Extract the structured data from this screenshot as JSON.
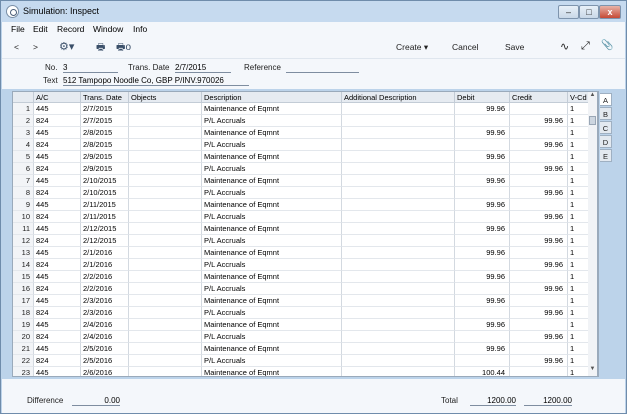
{
  "window": {
    "title": "Simulation: Inspect",
    "min_label": "–",
    "max_label": "□",
    "close_label": "x"
  },
  "menubar": [
    {
      "label": "File"
    },
    {
      "label": "Edit"
    },
    {
      "label": "Record"
    },
    {
      "label": "Window"
    },
    {
      "label": "Info"
    }
  ],
  "toolbar": {
    "back": "<",
    "forward": ">",
    "gear": "⚙▾",
    "print": "🖶",
    "preview": "🖶o",
    "create": "Create ▾",
    "cancel": "Cancel",
    "save": "Save",
    "wave": "∿",
    "expand": "⤢",
    "attach": "📎"
  },
  "header": {
    "no_label": "No.",
    "no_value": "3",
    "transdate_label": "Trans. Date",
    "transdate_value": "2/7/2015",
    "reference_label": "Reference",
    "reference_value": "",
    "text_label": "Text",
    "text_value": "512 Tampopo Noodle Co, GBP  P/INV.970026"
  },
  "grid": {
    "columns": [
      "",
      "A/C",
      "Trans. Date",
      "Objects",
      "Description",
      "Additional Description",
      "Debit",
      "Credit",
      "V-Cd"
    ],
    "rows": [
      [
        "1",
        "445",
        "2/7/2015",
        "",
        "Maintenance of Eqmnt",
        "",
        "99.96",
        "",
        "1"
      ],
      [
        "2",
        "824",
        "2/7/2015",
        "",
        "P/L  Accruals",
        "",
        "",
        "99.96",
        "1"
      ],
      [
        "3",
        "445",
        "2/8/2015",
        "",
        "Maintenance of Eqmnt",
        "",
        "99.96",
        "",
        "1"
      ],
      [
        "4",
        "824",
        "2/8/2015",
        "",
        "P/L  Accruals",
        "",
        "",
        "99.96",
        "1"
      ],
      [
        "5",
        "445",
        "2/9/2015",
        "",
        "Maintenance of Eqmnt",
        "",
        "99.96",
        "",
        "1"
      ],
      [
        "6",
        "824",
        "2/9/2015",
        "",
        "P/L  Accruals",
        "",
        "",
        "99.96",
        "1"
      ],
      [
        "7",
        "445",
        "2/10/2015",
        "",
        "Maintenance of Eqmnt",
        "",
        "99.96",
        "",
        "1"
      ],
      [
        "8",
        "824",
        "2/10/2015",
        "",
        "P/L  Accruals",
        "",
        "",
        "99.96",
        "1"
      ],
      [
        "9",
        "445",
        "2/11/2015",
        "",
        "Maintenance of Eqmnt",
        "",
        "99.96",
        "",
        "1"
      ],
      [
        "10",
        "824",
        "2/11/2015",
        "",
        "P/L  Accruals",
        "",
        "",
        "99.96",
        "1"
      ],
      [
        "11",
        "445",
        "2/12/2015",
        "",
        "Maintenance of Eqmnt",
        "",
        "99.96",
        "",
        "1"
      ],
      [
        "12",
        "824",
        "2/12/2015",
        "",
        "P/L  Accruals",
        "",
        "",
        "99.96",
        "1"
      ],
      [
        "13",
        "445",
        "2/1/2016",
        "",
        "Maintenance of Eqmnt",
        "",
        "99.96",
        "",
        "1"
      ],
      [
        "14",
        "824",
        "2/1/2016",
        "",
        "P/L  Accruals",
        "",
        "",
        "99.96",
        "1"
      ],
      [
        "15",
        "445",
        "2/2/2016",
        "",
        "Maintenance of Eqmnt",
        "",
        "99.96",
        "",
        "1"
      ],
      [
        "16",
        "824",
        "2/2/2016",
        "",
        "P/L  Accruals",
        "",
        "",
        "99.96",
        "1"
      ],
      [
        "17",
        "445",
        "2/3/2016",
        "",
        "Maintenance of Eqmnt",
        "",
        "99.96",
        "",
        "1"
      ],
      [
        "18",
        "824",
        "2/3/2016",
        "",
        "P/L  Accruals",
        "",
        "",
        "99.96",
        "1"
      ],
      [
        "19",
        "445",
        "2/4/2016",
        "",
        "Maintenance of Eqmnt",
        "",
        "99.96",
        "",
        "1"
      ],
      [
        "20",
        "824",
        "2/4/2016",
        "",
        "P/L  Accruals",
        "",
        "",
        "99.96",
        "1"
      ],
      [
        "21",
        "445",
        "2/5/2016",
        "",
        "Maintenance of Eqmnt",
        "",
        "99.96",
        "",
        "1"
      ],
      [
        "22",
        "824",
        "2/5/2016",
        "",
        "P/L  Accruals",
        "",
        "",
        "99.96",
        "1"
      ],
      [
        "23",
        "445",
        "2/6/2016",
        "",
        "Maintenance of Eqmnt",
        "",
        "100.44",
        "",
        "1"
      ]
    ]
  },
  "tabs": [
    "A",
    "B",
    "C",
    "D",
    "E"
  ],
  "footer": {
    "difference_label": "Difference",
    "difference_value": "0.00",
    "total_label": "Total",
    "total_debit": "1200.00",
    "total_credit": "1200.00"
  }
}
